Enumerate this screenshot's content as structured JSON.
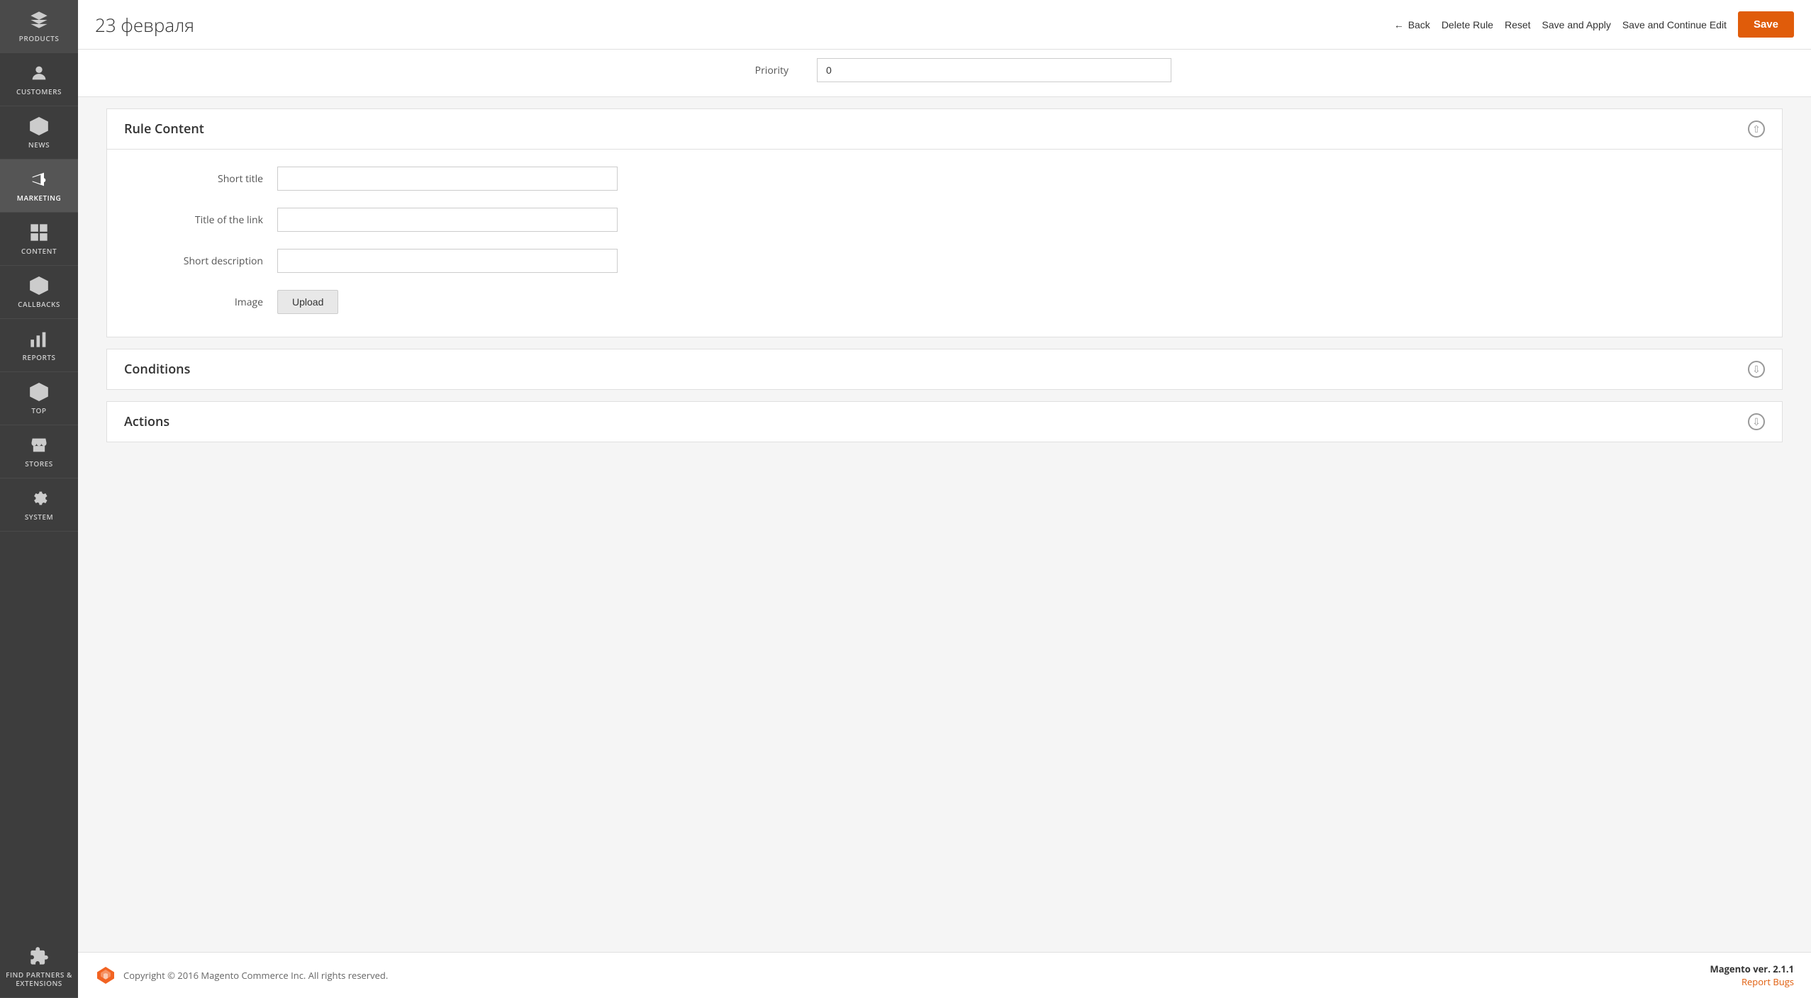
{
  "page": {
    "title": "23 февраля"
  },
  "header": {
    "back_label": "Back",
    "delete_label": "Delete Rule",
    "reset_label": "Reset",
    "save_apply_label": "Save and Apply",
    "save_continue_label": "Save and Continue Edit",
    "save_label": "Save"
  },
  "sidebar": {
    "items": [
      {
        "id": "products",
        "label": "PRODUCTS",
        "icon": "box-icon"
      },
      {
        "id": "customers",
        "label": "CUSTOMERS",
        "icon": "person-icon"
      },
      {
        "id": "news",
        "label": "NEWS",
        "icon": "hexagon-icon"
      },
      {
        "id": "marketing",
        "label": "MARKETING",
        "icon": "megaphone-icon",
        "active": true
      },
      {
        "id": "content",
        "label": "CONTENT",
        "icon": "grid-icon"
      },
      {
        "id": "callbacks",
        "label": "CALLBACKS",
        "icon": "hexagon2-icon"
      },
      {
        "id": "reports",
        "label": "REPORTS",
        "icon": "bar-chart-icon"
      },
      {
        "id": "top",
        "label": "TOP",
        "icon": "top-icon"
      },
      {
        "id": "stores",
        "label": "STORES",
        "icon": "store-icon"
      },
      {
        "id": "system",
        "label": "SYSTEM",
        "icon": "gear-icon"
      },
      {
        "id": "find-partners",
        "label": "FIND PARTNERS & EXTENSIONS",
        "icon": "puzzle-icon"
      }
    ]
  },
  "priority_field": {
    "label": "Priority",
    "value": "0"
  },
  "rule_content": {
    "title": "Rule Content",
    "expanded": true,
    "fields": [
      {
        "id": "short-title",
        "label": "Short title",
        "value": "",
        "placeholder": ""
      },
      {
        "id": "title-link",
        "label": "Title of the link",
        "value": "",
        "placeholder": ""
      },
      {
        "id": "short-description",
        "label": "Short description",
        "value": "",
        "placeholder": ""
      }
    ],
    "image_label": "Image",
    "upload_label": "Upload"
  },
  "conditions": {
    "title": "Conditions",
    "expanded": false
  },
  "actions": {
    "title": "Actions",
    "expanded": false
  },
  "footer": {
    "copyright": "Copyright © 2016 Magento Commerce Inc. All rights reserved.",
    "magento_label": "Magento",
    "version": "ver. 2.1.1",
    "report_label": "Report Bugs"
  }
}
